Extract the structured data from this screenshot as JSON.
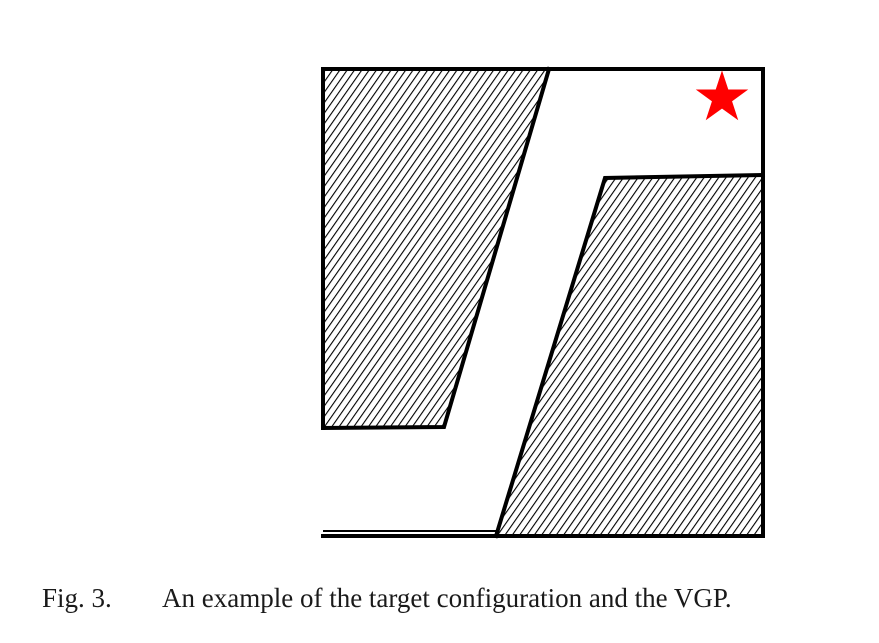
{
  "figure": {
    "colors": {
      "wall_stroke": "#000000",
      "hatch": "#000000",
      "free_space": "#ffffff",
      "target_marker": "#ff0000"
    },
    "icons": {
      "target": "star-icon"
    }
  },
  "caption": {
    "label": "Fig. 3.",
    "text": "An example of the target configuration and the VGP."
  }
}
